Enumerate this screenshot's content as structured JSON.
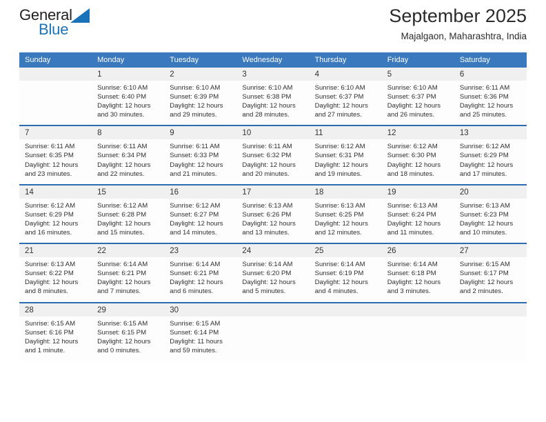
{
  "logo": {
    "primary_text": "General",
    "secondary_text": "Blue",
    "primary_color": "#231f20",
    "secondary_color": "#1a73b8",
    "triangle_name": "blue-triangle-mark"
  },
  "header": {
    "title": "September 2025",
    "subtitle": "Majalgaon, Maharashtra, India"
  },
  "theme": {
    "header_blue": "#3a79bd",
    "row_border_blue": "#2b6cb0",
    "daynum_band": "#f0f0f0"
  },
  "weekday_headers": [
    "Sunday",
    "Monday",
    "Tuesday",
    "Wednesday",
    "Thursday",
    "Friday",
    "Saturday"
  ],
  "weeks": [
    [
      {
        "day": "",
        "sunrise": "",
        "sunset": "",
        "daylight": "",
        "empty": true
      },
      {
        "day": "1",
        "sunrise": "Sunrise: 6:10 AM",
        "sunset": "Sunset: 6:40 PM",
        "daylight": "Daylight: 12 hours and 30 minutes."
      },
      {
        "day": "2",
        "sunrise": "Sunrise: 6:10 AM",
        "sunset": "Sunset: 6:39 PM",
        "daylight": "Daylight: 12 hours and 29 minutes."
      },
      {
        "day": "3",
        "sunrise": "Sunrise: 6:10 AM",
        "sunset": "Sunset: 6:38 PM",
        "daylight": "Daylight: 12 hours and 28 minutes."
      },
      {
        "day": "4",
        "sunrise": "Sunrise: 6:10 AM",
        "sunset": "Sunset: 6:37 PM",
        "daylight": "Daylight: 12 hours and 27 minutes."
      },
      {
        "day": "5",
        "sunrise": "Sunrise: 6:10 AM",
        "sunset": "Sunset: 6:37 PM",
        "daylight": "Daylight: 12 hours and 26 minutes."
      },
      {
        "day": "6",
        "sunrise": "Sunrise: 6:11 AM",
        "sunset": "Sunset: 6:36 PM",
        "daylight": "Daylight: 12 hours and 25 minutes."
      }
    ],
    [
      {
        "day": "7",
        "sunrise": "Sunrise: 6:11 AM",
        "sunset": "Sunset: 6:35 PM",
        "daylight": "Daylight: 12 hours and 23 minutes."
      },
      {
        "day": "8",
        "sunrise": "Sunrise: 6:11 AM",
        "sunset": "Sunset: 6:34 PM",
        "daylight": "Daylight: 12 hours and 22 minutes."
      },
      {
        "day": "9",
        "sunrise": "Sunrise: 6:11 AM",
        "sunset": "Sunset: 6:33 PM",
        "daylight": "Daylight: 12 hours and 21 minutes."
      },
      {
        "day": "10",
        "sunrise": "Sunrise: 6:11 AM",
        "sunset": "Sunset: 6:32 PM",
        "daylight": "Daylight: 12 hours and 20 minutes."
      },
      {
        "day": "11",
        "sunrise": "Sunrise: 6:12 AM",
        "sunset": "Sunset: 6:31 PM",
        "daylight": "Daylight: 12 hours and 19 minutes."
      },
      {
        "day": "12",
        "sunrise": "Sunrise: 6:12 AM",
        "sunset": "Sunset: 6:30 PM",
        "daylight": "Daylight: 12 hours and 18 minutes."
      },
      {
        "day": "13",
        "sunrise": "Sunrise: 6:12 AM",
        "sunset": "Sunset: 6:29 PM",
        "daylight": "Daylight: 12 hours and 17 minutes."
      }
    ],
    [
      {
        "day": "14",
        "sunrise": "Sunrise: 6:12 AM",
        "sunset": "Sunset: 6:29 PM",
        "daylight": "Daylight: 12 hours and 16 minutes."
      },
      {
        "day": "15",
        "sunrise": "Sunrise: 6:12 AM",
        "sunset": "Sunset: 6:28 PM",
        "daylight": "Daylight: 12 hours and 15 minutes."
      },
      {
        "day": "16",
        "sunrise": "Sunrise: 6:12 AM",
        "sunset": "Sunset: 6:27 PM",
        "daylight": "Daylight: 12 hours and 14 minutes."
      },
      {
        "day": "17",
        "sunrise": "Sunrise: 6:13 AM",
        "sunset": "Sunset: 6:26 PM",
        "daylight": "Daylight: 12 hours and 13 minutes."
      },
      {
        "day": "18",
        "sunrise": "Sunrise: 6:13 AM",
        "sunset": "Sunset: 6:25 PM",
        "daylight": "Daylight: 12 hours and 12 minutes."
      },
      {
        "day": "19",
        "sunrise": "Sunrise: 6:13 AM",
        "sunset": "Sunset: 6:24 PM",
        "daylight": "Daylight: 12 hours and 11 minutes."
      },
      {
        "day": "20",
        "sunrise": "Sunrise: 6:13 AM",
        "sunset": "Sunset: 6:23 PM",
        "daylight": "Daylight: 12 hours and 10 minutes."
      }
    ],
    [
      {
        "day": "21",
        "sunrise": "Sunrise: 6:13 AM",
        "sunset": "Sunset: 6:22 PM",
        "daylight": "Daylight: 12 hours and 8 minutes."
      },
      {
        "day": "22",
        "sunrise": "Sunrise: 6:14 AM",
        "sunset": "Sunset: 6:21 PM",
        "daylight": "Daylight: 12 hours and 7 minutes."
      },
      {
        "day": "23",
        "sunrise": "Sunrise: 6:14 AM",
        "sunset": "Sunset: 6:21 PM",
        "daylight": "Daylight: 12 hours and 6 minutes."
      },
      {
        "day": "24",
        "sunrise": "Sunrise: 6:14 AM",
        "sunset": "Sunset: 6:20 PM",
        "daylight": "Daylight: 12 hours and 5 minutes."
      },
      {
        "day": "25",
        "sunrise": "Sunrise: 6:14 AM",
        "sunset": "Sunset: 6:19 PM",
        "daylight": "Daylight: 12 hours and 4 minutes."
      },
      {
        "day": "26",
        "sunrise": "Sunrise: 6:14 AM",
        "sunset": "Sunset: 6:18 PM",
        "daylight": "Daylight: 12 hours and 3 minutes."
      },
      {
        "day": "27",
        "sunrise": "Sunrise: 6:15 AM",
        "sunset": "Sunset: 6:17 PM",
        "daylight": "Daylight: 12 hours and 2 minutes."
      }
    ],
    [
      {
        "day": "28",
        "sunrise": "Sunrise: 6:15 AM",
        "sunset": "Sunset: 6:16 PM",
        "daylight": "Daylight: 12 hours and 1 minute."
      },
      {
        "day": "29",
        "sunrise": "Sunrise: 6:15 AM",
        "sunset": "Sunset: 6:15 PM",
        "daylight": "Daylight: 12 hours and 0 minutes."
      },
      {
        "day": "30",
        "sunrise": "Sunrise: 6:15 AM",
        "sunset": "Sunset: 6:14 PM",
        "daylight": "Daylight: 11 hours and 59 minutes."
      },
      {
        "day": "",
        "sunrise": "",
        "sunset": "",
        "daylight": "",
        "empty": true
      },
      {
        "day": "",
        "sunrise": "",
        "sunset": "",
        "daylight": "",
        "empty": true
      },
      {
        "day": "",
        "sunrise": "",
        "sunset": "",
        "daylight": "",
        "empty": true
      },
      {
        "day": "",
        "sunrise": "",
        "sunset": "",
        "daylight": "",
        "empty": true
      }
    ]
  ]
}
